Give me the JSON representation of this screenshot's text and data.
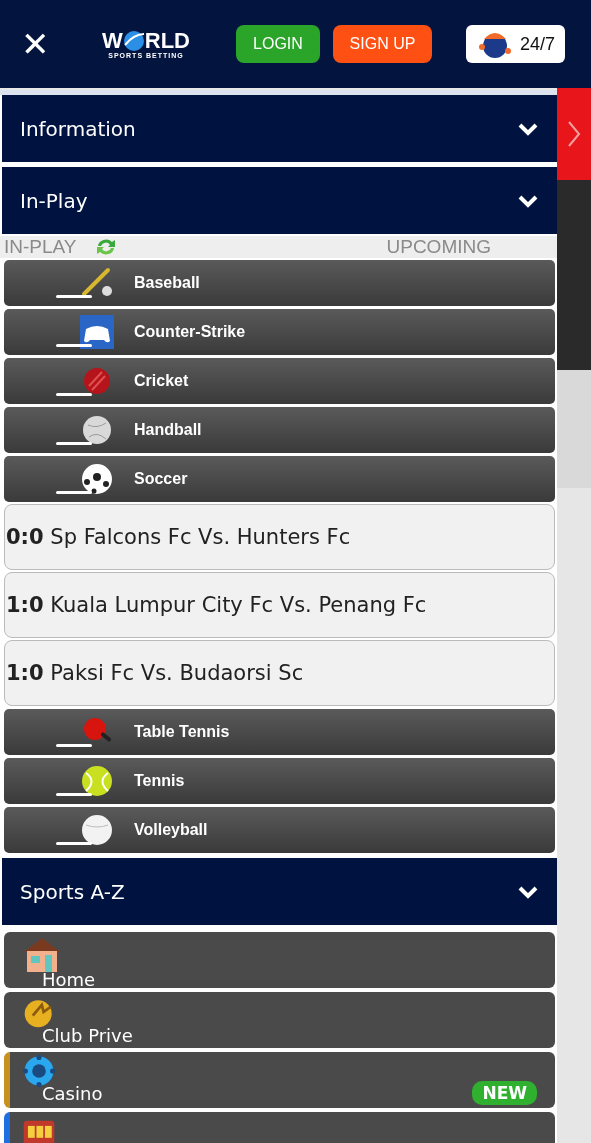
{
  "header": {
    "close": "✕",
    "logo": {
      "start": "W",
      "end": "RLD",
      "tagline": "SPORTS BETTING"
    },
    "buttons": [
      {
        "kind": "login",
        "label": "LOGIN"
      },
      {
        "kind": "signup",
        "label": "SIGN UP"
      }
    ],
    "support": "24/7"
  },
  "sections": [
    {
      "title": "Information"
    },
    {
      "title": "In-Play"
    }
  ],
  "inplay": {
    "tabs": [
      {
        "label": "IN-PLAY"
      },
      {
        "label": "UPCOMING"
      }
    ],
    "sports": [
      {
        "name": "Baseball"
      },
      {
        "name": "Counter-Strike"
      },
      {
        "name": "Cricket"
      },
      {
        "name": "Handball"
      },
      {
        "name": "Soccer",
        "matches": [
          {
            "score": "0:0",
            "teams": "Sp Falcons Fc Vs. Hunters Fc"
          },
          {
            "score": "1:0",
            "teams": "Kuala Lumpur City Fc Vs. Penang Fc"
          },
          {
            "score": "1:0",
            "teams": "Paksi Fc Vs. Budaorsi Sc"
          }
        ]
      },
      {
        "name": "Table Tennis"
      },
      {
        "name": "Tennis"
      },
      {
        "name": "Volleyball"
      }
    ]
  },
  "sports_az": {
    "title": "Sports A-Z"
  },
  "menu": [
    {
      "label": "Home"
    },
    {
      "label": "Club Prive"
    },
    {
      "label": "Casino",
      "color": "#c8901e",
      "badge": "NEW"
    },
    {
      "color": "#1e6fe0"
    }
  ]
}
